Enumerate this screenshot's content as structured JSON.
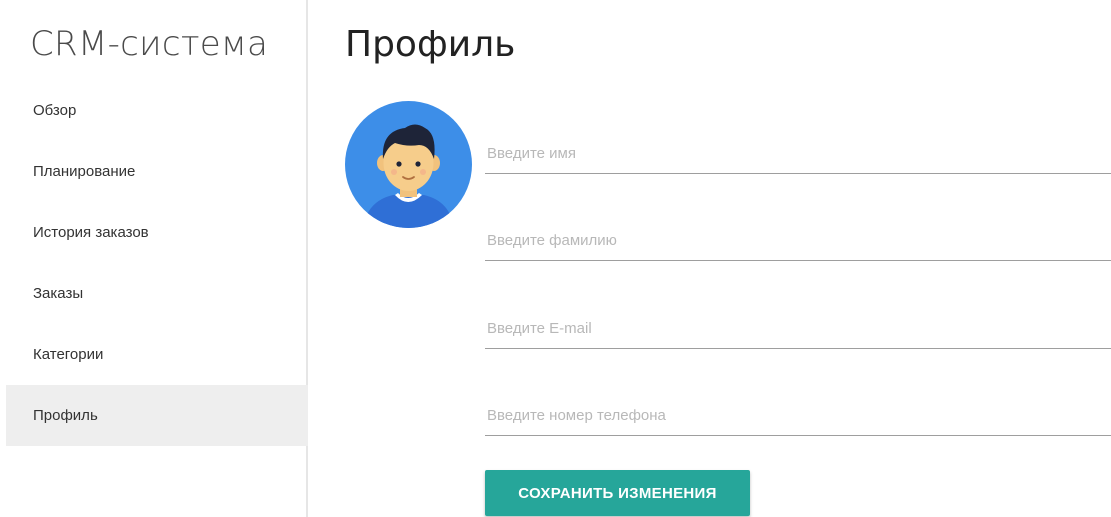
{
  "sidebar": {
    "brand": "CRM-система",
    "items": [
      {
        "label": "Обзор",
        "active": false
      },
      {
        "label": "Планирование",
        "active": false
      },
      {
        "label": "История заказов",
        "active": false
      },
      {
        "label": "Заказы",
        "active": false
      },
      {
        "label": "Категории",
        "active": false
      },
      {
        "label": "Профиль",
        "active": true
      }
    ]
  },
  "main": {
    "title": "Профиль",
    "form": {
      "name_placeholder": "Введите имя",
      "surname_placeholder": "Введите фамилию",
      "email_placeholder": "Введите E-mail",
      "phone_placeholder": "Введите номер телефона",
      "save_label": "СОХРАНИТЬ ИЗМЕНЕНИЯ"
    }
  },
  "colors": {
    "accent": "#26a69a",
    "active_item_bg": "#eeeeee",
    "avatar_bg": "#3d8ee8"
  },
  "icons": {
    "avatar": "user-avatar-icon"
  }
}
